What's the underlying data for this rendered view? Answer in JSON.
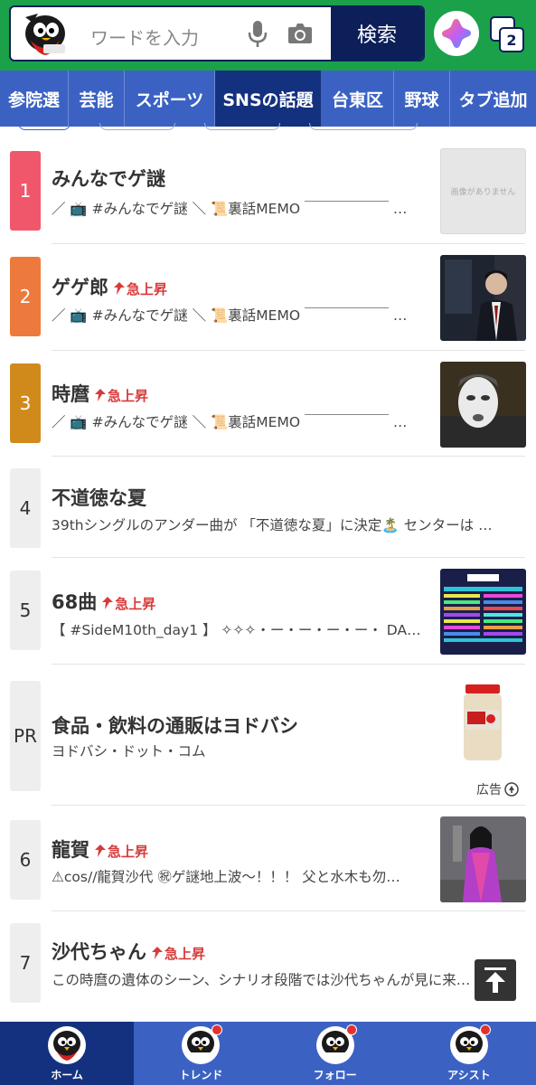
{
  "header": {
    "search_placeholder": "ワードを入力",
    "search_button": "検索",
    "tab_count": "2",
    "logo_icon": "swallow-mascot-icon",
    "mic_icon": "mic-icon",
    "camera_icon": "camera-icon",
    "assistant_icon": "ai-assistant-icon"
  },
  "categories": [
    {
      "label": "参院選",
      "active": false
    },
    {
      "label": "芸能",
      "active": false
    },
    {
      "label": "スポーツ",
      "active": false
    },
    {
      "label": "SNSの話題",
      "active": true
    },
    {
      "label": "台東区",
      "active": false
    },
    {
      "label": "野球",
      "active": false
    },
    {
      "label": "タブ追加",
      "active": false
    }
  ],
  "rising_label": "急上昇",
  "items": [
    {
      "rank": "1",
      "title": "みんなでゲ謎",
      "rising": false,
      "desc": "／ 📺 #みんなでゲ謎 ＼ 📜裏話MEMO ￣￣￣￣￣￣ …",
      "thumb": "no-image",
      "noimage_text": "画像がありません"
    },
    {
      "rank": "2",
      "title": "ゲゲ郎",
      "rising": true,
      "desc": "／ 📺 #みんなでゲ謎 ＼ 📜裏話MEMO ￣￣￣￣￣￣ …",
      "thumb": "anime-man-suit"
    },
    {
      "rank": "3",
      "title": "時麿",
      "rising": true,
      "desc": "／ 📺 #みんなでゲ謎 ＼ 📜裏話MEMO ￣￣￣￣￣￣ …",
      "thumb": "anime-pale-face"
    },
    {
      "rank": "4",
      "title": "不道徳な夏",
      "rising": false,
      "desc": "39thシングルのアンダー曲が 「不道徳な夏」に決定🏝️ センターは …",
      "thumb": ""
    },
    {
      "rank": "5",
      "title": "68曲",
      "rising": true,
      "desc": "【 #SideM10th_day1 】 ✧✧✧・ー・ー・ー・ー・ DA…",
      "thumb": "setlist-table"
    },
    {
      "rank": "PR",
      "title": "食品・飲料の通販はヨドバシ",
      "rising": false,
      "desc": "ヨドバシ・ドット・コム",
      "thumb": "product-jar",
      "ad_label": "広告"
    },
    {
      "rank": "6",
      "title": "龍賀",
      "rising": true,
      "desc": "⚠cos//龍賀沙代 ㊗ゲ謎地上波〜！！！ 父と水木も勿…",
      "thumb": "cosplay-kimono"
    },
    {
      "rank": "7",
      "title": "沙代ちゃん",
      "rising": true,
      "desc": "この時麿の遺体のシーン、シナリオ段階では沙代ちゃんが見に来…",
      "thumb": ""
    }
  ],
  "bottom_nav": [
    {
      "label": "ホーム",
      "active": true,
      "badge": false
    },
    {
      "label": "トレンド",
      "active": false,
      "badge": true
    },
    {
      "label": "フォロー",
      "active": false,
      "badge": true
    },
    {
      "label": "アシスト",
      "active": false,
      "badge": true
    }
  ],
  "colors": {
    "header_green": "#1aa14a",
    "navy": "#0d1f58",
    "category_blue": "#3b62c3",
    "category_active": "#14317f",
    "rank1": "#f0576b",
    "rank2": "#ed7a3c",
    "rank3": "#d08a1c",
    "rank_default": "#eeeeee",
    "rising_red": "#d83a3a"
  }
}
